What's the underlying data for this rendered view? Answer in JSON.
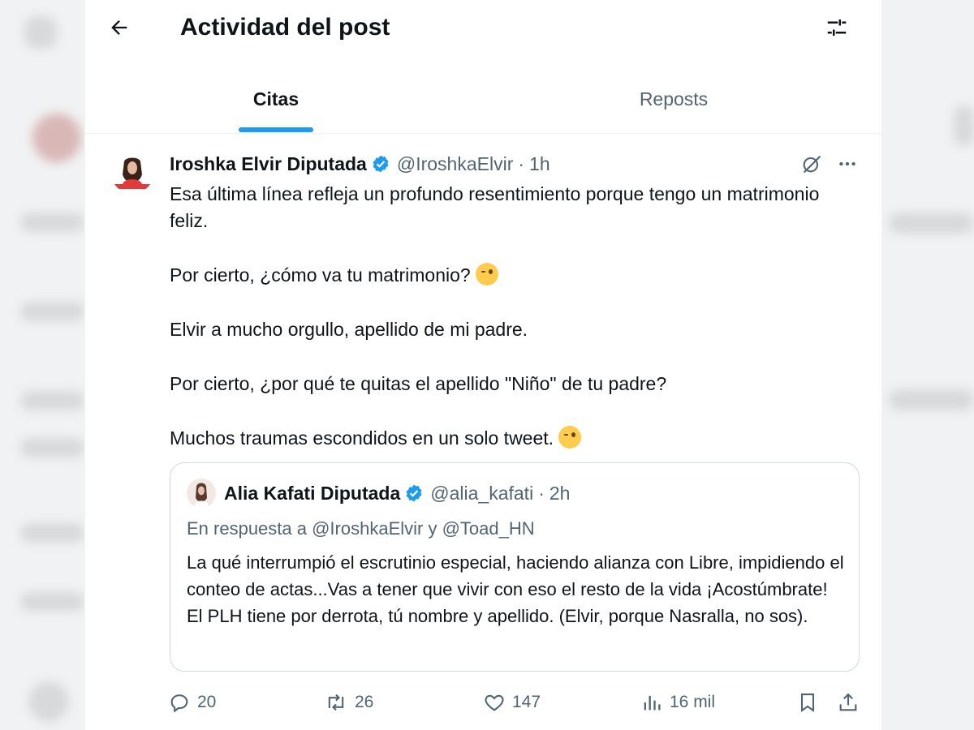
{
  "header": {
    "title": "Actividad del post"
  },
  "tabs": [
    {
      "label": "Citas",
      "active": true
    },
    {
      "label": "Reposts",
      "active": false
    }
  ],
  "post": {
    "author_name": "Iroshka Elvir Diputada",
    "handle": "@IroshkaElvir",
    "separator": "·",
    "time": "1h",
    "paragraphs": [
      "Esa última línea refleja un profundo resentimiento porque tengo un matrimonio feliz.",
      "Por cierto, ¿cómo va tu matrimonio?",
      "Elvir a mucho orgullo, apellido de mi padre.",
      "Por cierto, ¿por qué te quitas el apellido \"Niño\" de tu padre?",
      "Muchos traumas escondidos en un solo tweet."
    ],
    "emoji": "winking-face-emoji",
    "quote": {
      "author_name": "Alia Kafati Diputada",
      "handle": "@alia_kafati",
      "separator": "·",
      "time": "2h",
      "replying_to": "En respuesta a @IroshkaElvir y @Toad_HN",
      "text": "La qué interrumpió el escrutinio especial, haciendo alianza con Libre, impidiendo el conteo de actas...Vas a tener que vivir con eso el resto de la vida ¡Acostúmbrate! El PLH tiene por derrota, tú nombre y apellido. (Elvir, porque Nasralla, no sos)."
    },
    "actions": {
      "replies": "20",
      "reposts": "26",
      "likes": "147",
      "views": "16 mil"
    }
  },
  "icons": {
    "back": "arrow-left-icon",
    "filter": "sliders-icon",
    "verified": "verified-badge-icon",
    "grok": "grok-icon",
    "more": "more-dots-icon",
    "reply": "reply-icon",
    "repost": "repost-icon",
    "like": "heart-icon",
    "views": "views-chart-icon",
    "bookmark": "bookmark-icon",
    "share": "share-icon"
  },
  "colors": {
    "accent": "#1d9bf0",
    "text": "#0f1419",
    "secondary": "#536471",
    "border": "#cfd9de"
  }
}
